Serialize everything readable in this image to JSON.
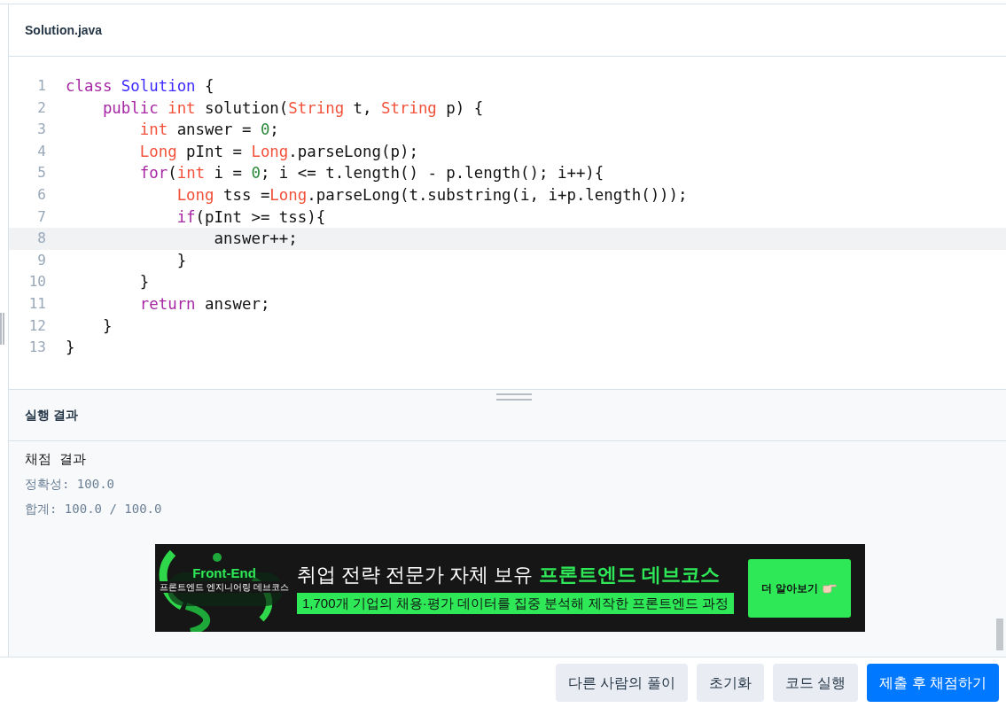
{
  "editor": {
    "filename": "Solution.java",
    "lines": [
      {
        "number": "1",
        "highlighted": false,
        "tokens": [
          {
            "kind": "keyword",
            "text": "class "
          },
          {
            "kind": "classname",
            "text": "Solution"
          },
          {
            "kind": "plain",
            "text": " {"
          }
        ]
      },
      {
        "number": "2",
        "highlighted": false,
        "tokens": [
          {
            "kind": "keyword",
            "text": "    public "
          },
          {
            "kind": "type",
            "text": "int"
          },
          {
            "kind": "plain",
            "text": " solution("
          },
          {
            "kind": "type",
            "text": "String"
          },
          {
            "kind": "plain",
            "text": " t, "
          },
          {
            "kind": "type",
            "text": "String"
          },
          {
            "kind": "plain",
            "text": " p) {"
          }
        ]
      },
      {
        "number": "3",
        "highlighted": false,
        "tokens": [
          {
            "kind": "type",
            "text": "        int"
          },
          {
            "kind": "plain",
            "text": " answer = "
          },
          {
            "kind": "number",
            "text": "0"
          },
          {
            "kind": "plain",
            "text": ";"
          }
        ]
      },
      {
        "number": "4",
        "highlighted": false,
        "tokens": [
          {
            "kind": "type",
            "text": "        Long"
          },
          {
            "kind": "plain",
            "text": " pInt = "
          },
          {
            "kind": "type",
            "text": "Long"
          },
          {
            "kind": "plain",
            "text": ".parseLong(p);"
          }
        ]
      },
      {
        "number": "5",
        "highlighted": false,
        "tokens": [
          {
            "kind": "keyword",
            "text": "        for"
          },
          {
            "kind": "plain",
            "text": "("
          },
          {
            "kind": "type",
            "text": "int"
          },
          {
            "kind": "plain",
            "text": " i = "
          },
          {
            "kind": "number",
            "text": "0"
          },
          {
            "kind": "plain",
            "text": "; i <= t.length() - p.length(); i++){"
          }
        ]
      },
      {
        "number": "6",
        "highlighted": false,
        "tokens": [
          {
            "kind": "type",
            "text": "            Long"
          },
          {
            "kind": "plain",
            "text": " tss ="
          },
          {
            "kind": "type",
            "text": "Long"
          },
          {
            "kind": "plain",
            "text": ".parseLong(t.substring(i, i+p.length()));"
          }
        ]
      },
      {
        "number": "7",
        "highlighted": false,
        "tokens": [
          {
            "kind": "keyword",
            "text": "            if"
          },
          {
            "kind": "plain",
            "text": "(pInt >= tss){"
          }
        ]
      },
      {
        "number": "8",
        "highlighted": true,
        "tokens": [
          {
            "kind": "plain",
            "text": "                answer++;"
          }
        ]
      },
      {
        "number": "9",
        "highlighted": false,
        "tokens": [
          {
            "kind": "plain",
            "text": "            }"
          }
        ]
      },
      {
        "number": "10",
        "highlighted": false,
        "tokens": [
          {
            "kind": "plain",
            "text": "        }"
          }
        ]
      },
      {
        "number": "11",
        "highlighted": false,
        "tokens": [
          {
            "kind": "keyword",
            "text": "        return"
          },
          {
            "kind": "plain",
            "text": " answer;"
          }
        ]
      },
      {
        "number": "12",
        "highlighted": false,
        "tokens": [
          {
            "kind": "plain",
            "text": "    }"
          }
        ]
      },
      {
        "number": "13",
        "highlighted": false,
        "tokens": [
          {
            "kind": "plain",
            "text": "}"
          }
        ]
      }
    ]
  },
  "results": {
    "title": "실행 결과",
    "heading": "채점 결과",
    "lines": [
      "정확성: 100.0",
      "합계: 100.0 / 100.0"
    ]
  },
  "banner": {
    "logo_title": "Front-End",
    "logo_subtitle": "프론트엔드 엔지니어링 데브코스",
    "headline": "취업 전략 전문가 자체 보유",
    "headline_highlight": "프론트엔드 데브코스",
    "subline": "1,700개 기업의 채용·평가 데이터를 집중 분석해 제작한 프론트엔드 과정",
    "cta": "더 알아보기"
  },
  "buttons": [
    {
      "label": "다른 사람의 풀이",
      "kind": "secondary"
    },
    {
      "label": "초기화",
      "kind": "secondary"
    },
    {
      "label": "코드 실행",
      "kind": "secondary"
    },
    {
      "label": "제출 후 채점하기",
      "kind": "primary"
    }
  ]
}
